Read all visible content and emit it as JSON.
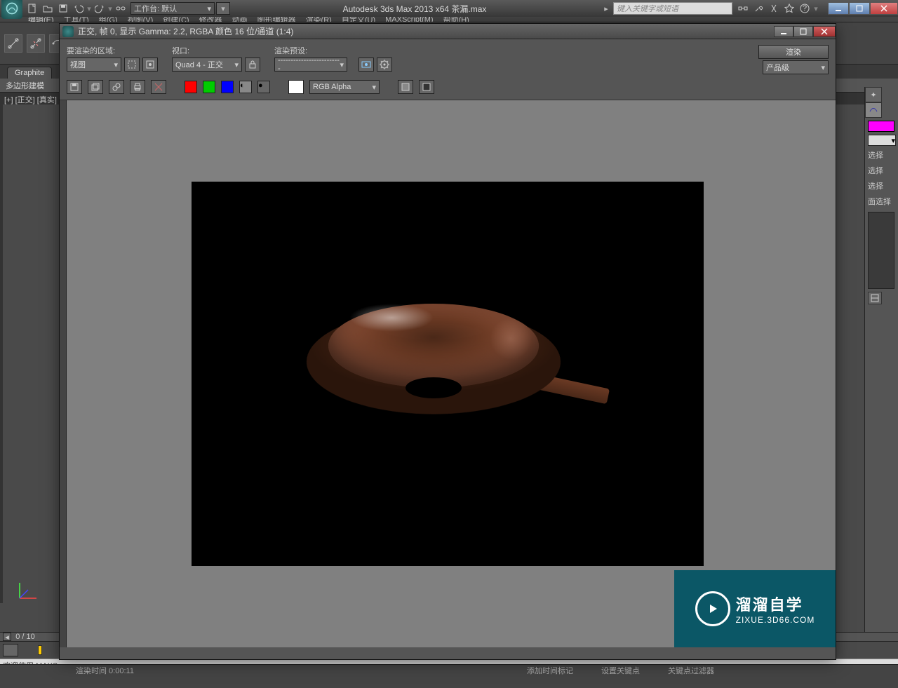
{
  "app": {
    "title_center": "Autodesk 3ds Max  2013 x64      茶漏.max",
    "workspace_label": "工作台: 默认",
    "search_placeholder": "键入关键字或短语"
  },
  "menu": [
    "编辑(E)",
    "工具(T)",
    "组(G)",
    "视图(V)",
    "创建(C)",
    "修改器",
    "动画",
    "图形编辑器",
    "渲染(R)",
    "自定义(U)",
    "MAXScript(M)",
    "帮助(H)"
  ],
  "ribbon": {
    "tab1": "Graphite",
    "tab2": "多边形建模"
  },
  "viewport_label": "[+] [正交] [真实]",
  "cmd_panel": {
    "sel_rows": [
      "选择",
      "选择",
      "选择",
      "面选择"
    ]
  },
  "render_window": {
    "title": "正交, 帧 0, 显示 Gamma: 2.2, RGBA 颜色 16 位/通道 (1:4)",
    "area_label": "要渲染的区域:",
    "area_value": "视图",
    "viewport_label": "视口:",
    "viewport_value": "Quad 4 - 正交",
    "preset_label": "渲染预设:",
    "preset_value": "-------------------------",
    "render_btn": "渲染",
    "quality_value": "产品级",
    "channel_dd": "RGB Alpha"
  },
  "watermark": {
    "line1": "溜溜自学",
    "line2": "ZIXUE.3D66.COM"
  },
  "slider": {
    "pos": "0 / 10"
  },
  "status": {
    "welcome": "欢迎使用 MAXS"
  },
  "render_status": {
    "time": "渲染时间 0:00:11",
    "add": "添加时间标记",
    "kf": "设置关键点",
    "kfsel": "关键点过滤器"
  }
}
